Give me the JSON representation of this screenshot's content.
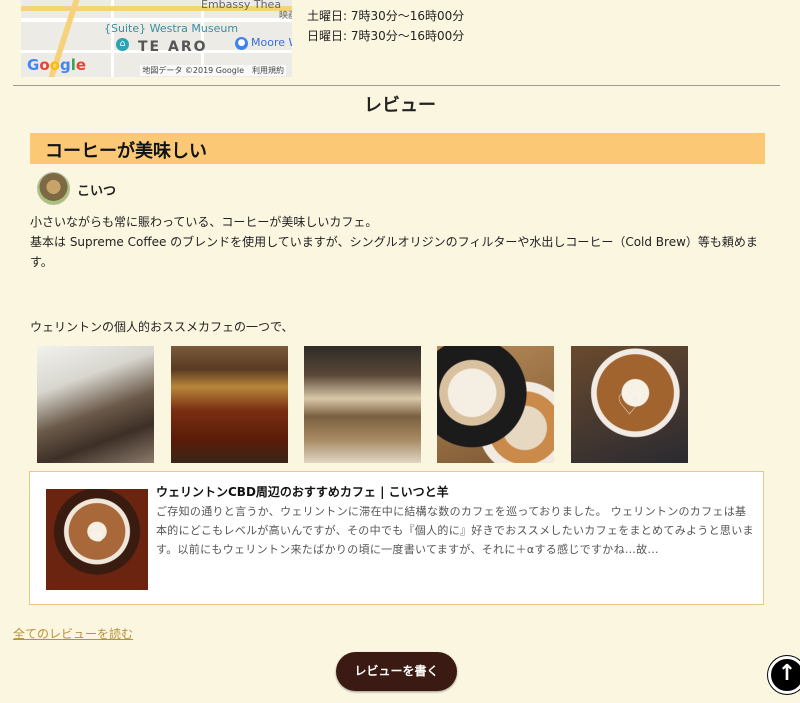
{
  "map": {
    "museum_label": "{Suite} Westra Museum",
    "area_label": "TE ARO",
    "moore_label": "Moore W",
    "top_label": "Embassy Thea",
    "top_right_label": "映画",
    "google_logo": [
      "G",
      "o",
      "o",
      "g",
      "l",
      "e"
    ],
    "credit": "地図データ ©2019 Google　利用規約"
  },
  "hours": {
    "saturday": "土曜日: 7時30分～16時00分",
    "sunday": "日曜日: 7時30分～16時00分"
  },
  "section_title": "レビュー",
  "review": {
    "title": "コーヒーが美味しい",
    "user_name": "こいつ",
    "body_line1": "小さいながらも常に賑わっている、コーヒーが美味しいカフェ。",
    "body_line2": "基本は Supreme Coffee のブレンドを使用していますが、シングルオリジンのフィルターや水出しコーヒー（Cold Brew）等も頼めます。",
    "intro": "ウェリントンの個人的おススメカフェの一つで、"
  },
  "card": {
    "title": "ウェリントンCBD周辺のおすすめカフェ | こいつと羊",
    "text": "ご存知の通りと言うか、ウェリントンに滞在中に結構な数のカフェを巡っておりました。 ウェリントンのカフェは基本的にどこもレベルが高いんですが、その中でも『個人的に』好きでおススメしたいカフェをまとめてみようと思います。以前にもウェリントン来たばかりの頃に一度書いてますが、それに＋αする感じですかね…故..."
  },
  "read_all_link": "全てのレビューを読む",
  "write_review_button": "レビューを書く",
  "icons": {
    "museum_pin": "museum-pin-icon",
    "moore_pin": "location-pin-icon",
    "back_to_top": "arrow-up-icon"
  },
  "colors": {
    "page_bg": "#fbf6e0",
    "review_header_bg": "#fbc976",
    "button_bg": "#3a1a12",
    "link": "#b8913f"
  }
}
